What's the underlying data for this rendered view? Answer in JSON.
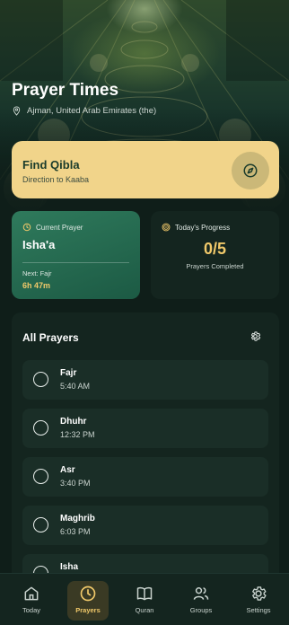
{
  "header": {
    "title": "Prayer Times",
    "location": "Ajman, United Arab Emirates (the)"
  },
  "qibla": {
    "title": "Find Qibla",
    "subtitle": "Direction to Kaaba"
  },
  "current_prayer": {
    "heading": "Current Prayer",
    "name": "Isha'a",
    "next_label": "Next: Fajr",
    "countdown": "6h 47m"
  },
  "progress": {
    "heading": "Today's Progress",
    "value": "0/5",
    "label": "Prayers Completed"
  },
  "all_prayers": {
    "title": "All Prayers",
    "items": [
      {
        "name": "Fajr",
        "time": "5:40 AM"
      },
      {
        "name": "Dhuhr",
        "time": "12:32 PM"
      },
      {
        "name": "Asr",
        "time": "3:40 PM"
      },
      {
        "name": "Maghrib",
        "time": "6:03 PM"
      },
      {
        "name": "Isha",
        "time": ""
      }
    ]
  },
  "nav": {
    "items": [
      {
        "label": "Today",
        "icon": "home-icon"
      },
      {
        "label": "Prayers",
        "icon": "clock-icon",
        "active": true
      },
      {
        "label": "Quran",
        "icon": "book-icon"
      },
      {
        "label": "Groups",
        "icon": "users-icon"
      },
      {
        "label": "Settings",
        "icon": "gear-icon"
      }
    ]
  },
  "colors": {
    "background": "#0f1e19",
    "accent_gold": "#f1c96a",
    "qibla_card": "#f1d48a",
    "current_card": "#2f7a5c",
    "card_dark": "#14251f"
  }
}
